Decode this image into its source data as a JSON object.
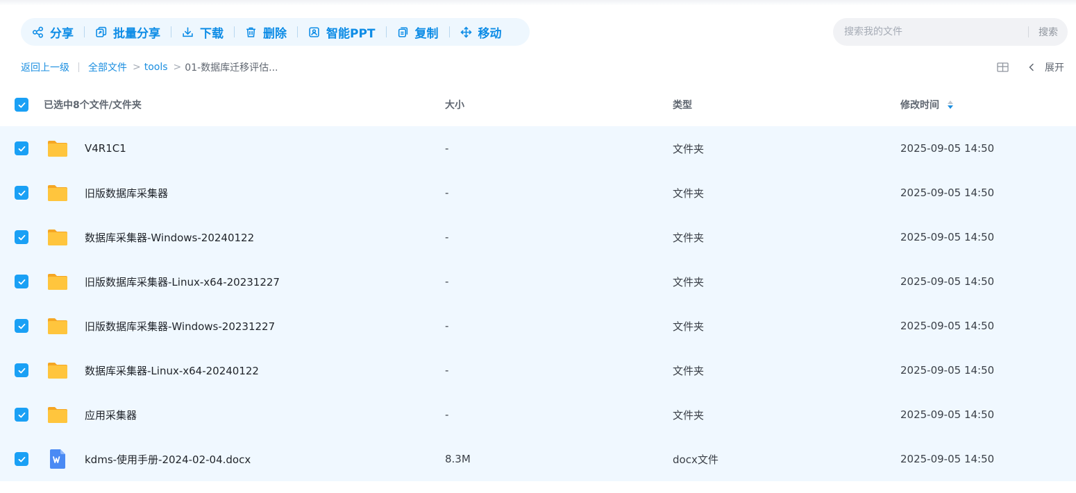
{
  "toolbar": {
    "share": "分享",
    "batch_share": "批量分享",
    "download": "下载",
    "delete": "删除",
    "smart_ppt": "智能PPT",
    "copy": "复制",
    "move": "移动"
  },
  "search": {
    "placeholder": "搜索我的文件",
    "button": "搜索"
  },
  "breadcrumb": {
    "back": "返回上一级",
    "all_files": "全部文件",
    "tools": "tools",
    "current": "01-数据库迁移评估..."
  },
  "view": {
    "expand": "展开"
  },
  "table": {
    "header": {
      "selected": "已选中8个文件/文件夹",
      "size": "大小",
      "type": "类型",
      "modified": "修改时间"
    },
    "rows": [
      {
        "name": "V4R1C1",
        "size": "-",
        "type": "文件夹",
        "modified": "2025-09-05 14:50"
      },
      {
        "name": "旧版数据库采集器",
        "size": "-",
        "type": "文件夹",
        "modified": "2025-09-05 14:50"
      },
      {
        "name": "数据库采集器-Windows-20240122",
        "size": "-",
        "type": "文件夹",
        "modified": "2025-09-05 14:50"
      },
      {
        "name": "旧版数据库采集器-Linux-x64-20231227",
        "size": "-",
        "type": "文件夹",
        "modified": "2025-09-05 14:50"
      },
      {
        "name": "旧版数据库采集器-Windows-20231227",
        "size": "-",
        "type": "文件夹",
        "modified": "2025-09-05 14:50"
      },
      {
        "name": "数据库采集器-Linux-x64-20240122",
        "size": "-",
        "type": "文件夹",
        "modified": "2025-09-05 14:50"
      },
      {
        "name": "应用采集器",
        "size": "-",
        "type": "文件夹",
        "modified": "2025-09-05 14:50"
      },
      {
        "name": "kdms-使用手册-2024-02-04.docx",
        "size": "8.3M",
        "type": "docx文件",
        "modified": "2025-09-05 14:50"
      }
    ]
  },
  "colors": {
    "accent": "#0d8ce6",
    "checkbox": "#1aa0f5",
    "row_selected_bg": "#f0f8ff",
    "folder": "#ffc53d",
    "word_doc": "#4a8af4"
  }
}
